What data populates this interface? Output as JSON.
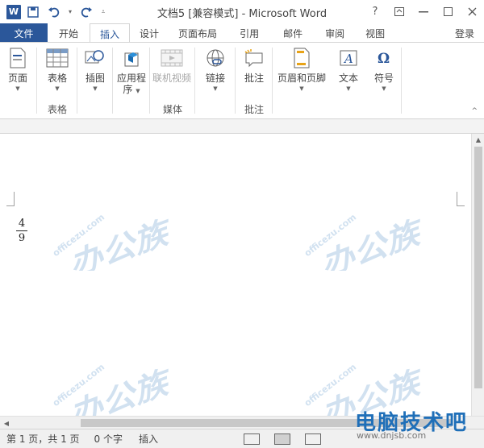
{
  "titlebar": {
    "title": "文档5 [兼容模式] - Microsoft Word",
    "help": "?",
    "qat_icons": [
      "word-logo-icon",
      "save-icon",
      "undo-icon",
      "redo-icon"
    ]
  },
  "tabs": {
    "items": [
      "文件",
      "开始",
      "插入",
      "设计",
      "页面布局",
      "引用",
      "邮件",
      "审阅",
      "视图"
    ],
    "active": "插入",
    "login": "登录"
  },
  "ribbon": {
    "groups": [
      {
        "label": "",
        "buttons": [
          {
            "label": "页面",
            "icon": "page-icon"
          }
        ]
      },
      {
        "label": "表格",
        "buttons": [
          {
            "label": "表格",
            "icon": "table-icon"
          }
        ]
      },
      {
        "label": "",
        "buttons": [
          {
            "label": "插图",
            "icon": "illustration-icon"
          },
          {
            "label": "应用程\n序",
            "icon": "apps-icon"
          }
        ]
      },
      {
        "label": "媒体",
        "buttons": [
          {
            "label": "联机视频",
            "icon": "video-icon",
            "disabled": true
          }
        ]
      },
      {
        "label": "",
        "buttons": [
          {
            "label": "链接",
            "icon": "link-icon"
          }
        ]
      },
      {
        "label": "批注",
        "buttons": [
          {
            "label": "批注",
            "icon": "comment-icon"
          }
        ]
      },
      {
        "label": "",
        "buttons": [
          {
            "label": "页眉和页脚",
            "icon": "header-footer-icon"
          },
          {
            "label": "文本",
            "icon": "text-icon"
          },
          {
            "label": "符号",
            "icon": "omega-icon"
          }
        ]
      }
    ]
  },
  "document": {
    "fraction": {
      "numerator": "4",
      "denominator": "9"
    },
    "watermark_url": "officezu.com"
  },
  "status": {
    "page": "第 1 页，共 1 页",
    "words": "0 个字",
    "mode": "插入"
  },
  "brand": {
    "name": "电脑技术吧",
    "url": "www.dnjsb.com"
  },
  "colors": {
    "accent": "#2b579a",
    "watermark": "#c9dcee"
  }
}
